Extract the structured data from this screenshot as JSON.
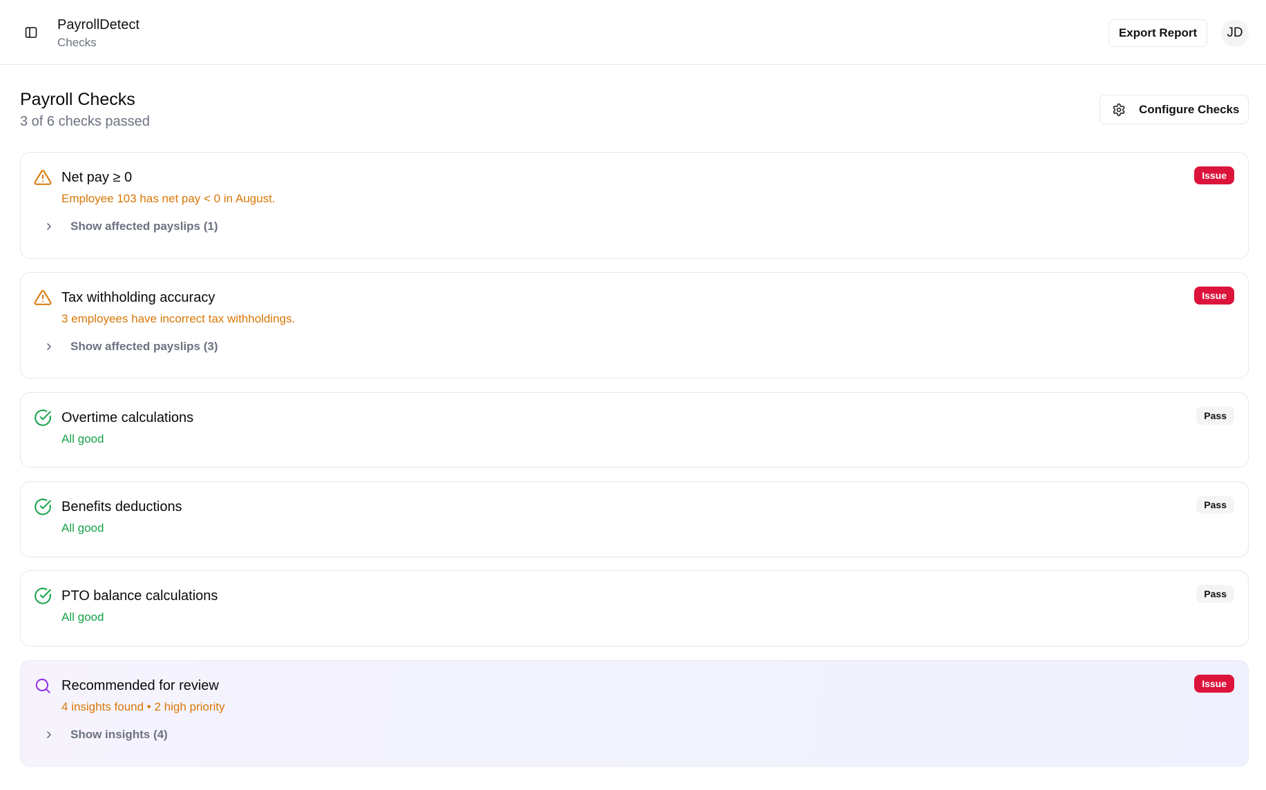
{
  "header": {
    "app_name": "PayrollDetect",
    "section": "Checks",
    "export_label": "Export Report",
    "avatar_initials": "JD"
  },
  "page": {
    "title": "Payroll Checks",
    "subtitle": "3 of 6 checks passed",
    "configure_label": "Configure Checks"
  },
  "checks": [
    {
      "title": "Net pay ≥ 0",
      "message": "Employee 103 has net pay < 0 in August.",
      "status": "Issue",
      "icon": "warning-icon",
      "expander": "Show affected payslips (1)"
    },
    {
      "title": "Tax withholding accuracy",
      "message": "3 employees have incorrect tax withholdings.",
      "status": "Issue",
      "icon": "warning-icon",
      "expander": "Show affected payslips (3)"
    },
    {
      "title": "Overtime calculations",
      "message": "All good",
      "status": "Pass",
      "icon": "check-circle-icon"
    },
    {
      "title": "Benefits deductions",
      "message": "All good",
      "status": "Pass",
      "icon": "check-circle-icon"
    },
    {
      "title": "PTO balance calculations",
      "message": "All good",
      "status": "Pass",
      "icon": "check-circle-icon"
    },
    {
      "title": "Recommended for review",
      "message": "4 insights found • 2 high priority",
      "status": "Issue",
      "icon": "search-icon",
      "expander": "Show insights (4)"
    }
  ],
  "colors": {
    "issue_badge": "#dc143c",
    "warning_text": "#d97706",
    "pass_text": "#16a34a",
    "insight_icon": "#9333ea"
  }
}
